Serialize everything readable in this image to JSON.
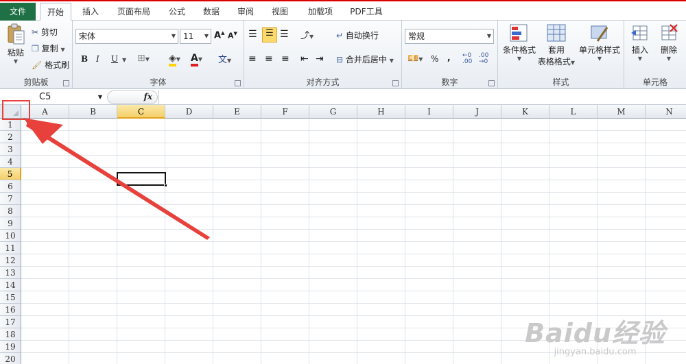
{
  "tabs": {
    "file": "文件",
    "items": [
      "开始",
      "插入",
      "页面布局",
      "公式",
      "数据",
      "审阅",
      "视图",
      "加载项",
      "PDF工具"
    ],
    "active": "开始"
  },
  "ribbon": {
    "clipboard": {
      "paste": "粘贴",
      "cut": "剪切",
      "copy": "复制",
      "format_painter": "格式刷",
      "label": "剪贴板"
    },
    "font": {
      "name": "宋体",
      "size": "11",
      "bold": "B",
      "italic": "I",
      "underline": "U",
      "label": "字体"
    },
    "alignment": {
      "wrap": "自动换行",
      "merge": "合并后居中",
      "label": "对齐方式"
    },
    "number": {
      "format": "常规",
      "percent": "%",
      "comma": ",",
      "label": "数字"
    },
    "styles": {
      "conditional": "条件格式",
      "table_line1": "套用",
      "table_line2": "表格格式",
      "cell_styles": "单元格样式",
      "label": "样式"
    },
    "cells": {
      "insert": "插入",
      "delete": "删除",
      "label": "单元格"
    }
  },
  "formula_bar": {
    "name_box": "C5",
    "fx": "fx",
    "content": ""
  },
  "grid": {
    "columns": [
      "A",
      "B",
      "C",
      "D",
      "E",
      "F",
      "G",
      "H",
      "I",
      "J",
      "K",
      "L",
      "M",
      "N"
    ],
    "rows": [
      "1",
      "2",
      "3",
      "4",
      "5",
      "6",
      "7",
      "8",
      "9",
      "10",
      "11",
      "12",
      "13",
      "14",
      "15",
      "16",
      "17",
      "18",
      "19",
      "20"
    ],
    "selected_column": "C",
    "selected_row": "5"
  },
  "watermark": {
    "main": "Baidu经验",
    "sub": "jingyan.baidu.com"
  },
  "colors": {
    "file_tab": "#1e7145",
    "annotation": "#e8413c",
    "selection_header": "#f5cf6a"
  }
}
